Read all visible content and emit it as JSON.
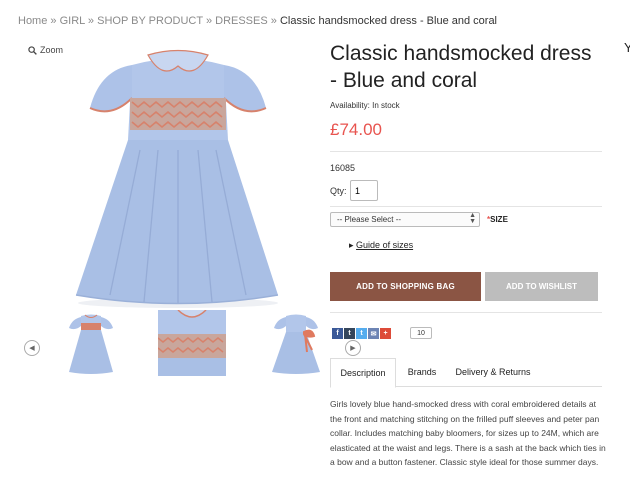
{
  "breadcrumb": {
    "items": [
      "Home",
      "GIRL",
      "SHOP BY PRODUCT",
      "DRESSES"
    ],
    "separator": "»",
    "current": "Classic handsmocked dress - Blue and coral"
  },
  "gallery": {
    "zoom_label": "Zoom",
    "thumbnails": [
      "thumb-1",
      "thumb-2",
      "thumb-3"
    ]
  },
  "product": {
    "title": "Classic handsmocked dress - Blue and coral",
    "right_edge_text": "Y",
    "availability": "Availability: In stock",
    "price": "£74.00",
    "sku": "16085",
    "qty_label": "Qty:",
    "qty_value": "1",
    "size_placeholder": "-- Please Select --",
    "size_required": "*",
    "size_label": "SIZE",
    "guide_arrow": "▸",
    "guide_label": "Guide of sizes",
    "add_to_bag": "ADD TO SHOPPING BAG",
    "add_to_wishlist": "ADD TO WISHLIST"
  },
  "social": {
    "buttons": [
      {
        "name": "facebook",
        "glyph": "f",
        "color": "#3b5998"
      },
      {
        "name": "tumblr",
        "glyph": "t",
        "color": "#35465c"
      },
      {
        "name": "twitter",
        "glyph": "t",
        "color": "#55acee"
      },
      {
        "name": "email",
        "glyph": "✉",
        "color": "#6d84b4"
      },
      {
        "name": "google-plus",
        "glyph": "+",
        "color": "#dd4b39"
      }
    ],
    "count": "10"
  },
  "tabs": [
    "Description",
    "Brands",
    "Delivery & Returns"
  ],
  "description": "Girls lovely blue hand-smocked dress with coral embroidered details at the front and matching stitching on the frilled puff sleeves and peter pan collar. Includes matching baby bloomers, for sizes up to 24M, which are elasticated at the waist and legs. There is a sash at the back which ties in a bow and a button fastener. Classic style ideal for those summer days.",
  "colors": {
    "price": "#e8544f",
    "primary_button": "#8b5544",
    "secondary_button": "#bdbdbd",
    "dress_blue": "#a7bde3",
    "smock_coral": "#d7826c"
  }
}
